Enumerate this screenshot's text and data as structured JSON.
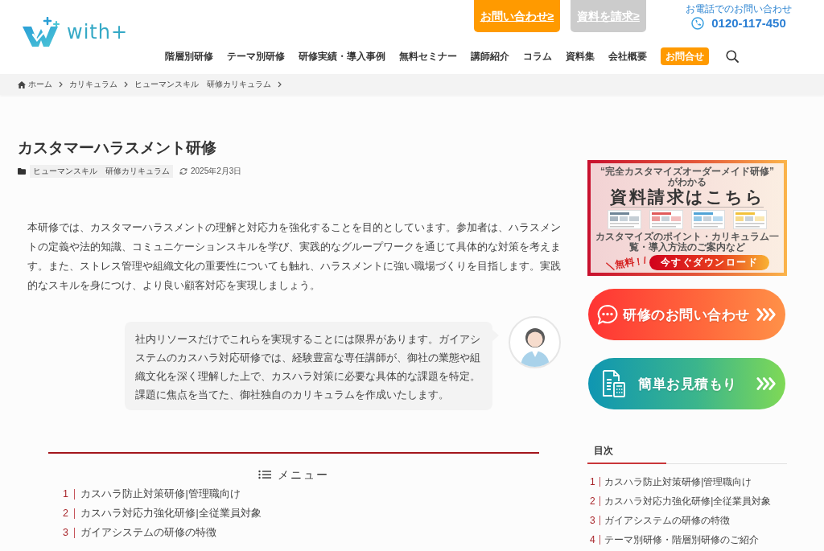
{
  "header": {
    "logo_text": "with+",
    "top_buttons": [
      {
        "label": "お問い合わせ≥",
        "kind": "primary"
      },
      {
        "label": "資料を請求≥",
        "kind": "secondary"
      }
    ],
    "phone": {
      "caption": "お電話でのお問い合わせ",
      "number": "0120-117-450"
    },
    "nav": [
      {
        "label": "階層別研修",
        "kind": "link"
      },
      {
        "label": "テーマ別研修",
        "kind": "link"
      },
      {
        "label": "研修実績・導入事例",
        "kind": "link"
      },
      {
        "label": "無料セミナー",
        "kind": "link"
      },
      {
        "label": "講師紹介",
        "kind": "link"
      },
      {
        "label": "コラム",
        "kind": "link"
      },
      {
        "label": "資料集",
        "kind": "link"
      },
      {
        "label": "会社概要",
        "kind": "link"
      },
      {
        "label": "お問合せ",
        "kind": "button"
      }
    ]
  },
  "breadcrumb": [
    "ホーム",
    "カリキュラム",
    "ヒューマンスキル　研修カリキュラム"
  ],
  "article": {
    "title": "カスタマーハラスメント研修",
    "category": "ヒューマンスキル　研修カリキュラム",
    "updated": "2025年2月3日",
    "intro": "本研修では、カスタマーハラスメントの理解と対応力を強化することを目的としています。参加者は、ハラスメントの定義や法的知識、コミュニケーションスキルを学び、実践的なグループワークを通じて具体的な対策を考えます。また、ストレス管理や組織文化の重要性についても触れ、ハラスメントに強い職場づくりを目指します。実践的なスキルを身につけ、より良い顧客対応を実現しましょう。",
    "speech": "社内リソースだけでこれらを実現することには限界があります。ガイアシステムのカスハラ対応研修では、経験豊富な専任講師が、御社の業態や組織文化を深く理解した上で、カスハラ対策に必要な具体的な課題を特定。課題に焦点を当てた、御社独自のカリキュラムを作成いたします。",
    "toc": {
      "title": "メニュー",
      "items": [
        {
          "number": "1",
          "label": "カスハラ防止対策研修|管理職向け"
        },
        {
          "number": "2",
          "label": "カスハラ対応力強化研修|全従業員対象"
        },
        {
          "number": "3",
          "label": "ガイアシステムの研修の特徴"
        }
      ]
    }
  },
  "sidebar": {
    "banner": {
      "subtitle": "“完全カスタマイズオーダーメイド研修” がわかる",
      "title": "資料請求はこちら",
      "caption": "カスタマイズのポイント・カリキュラム一覧・導入方法のご案内など",
      "badge": "＼無料！/",
      "button": "今すぐダウンロード"
    },
    "cta_buttons": [
      {
        "label": "研修のお問い合わせ",
        "kind": "contact"
      },
      {
        "label": "簡単お見積もり",
        "kind": "estimate"
      }
    ],
    "toc": {
      "title": "目次",
      "items": [
        {
          "number": "1",
          "label": "カスハラ防止対策研修|管理職向け"
        },
        {
          "number": "2",
          "label": "カスハラ対応力強化研修|全従業員対象"
        },
        {
          "number": "3",
          "label": "ガイアシステムの研修の特徴"
        },
        {
          "number": "4",
          "label": "テーマ別研修・階層別研修のご紹介"
        }
      ]
    }
  }
}
